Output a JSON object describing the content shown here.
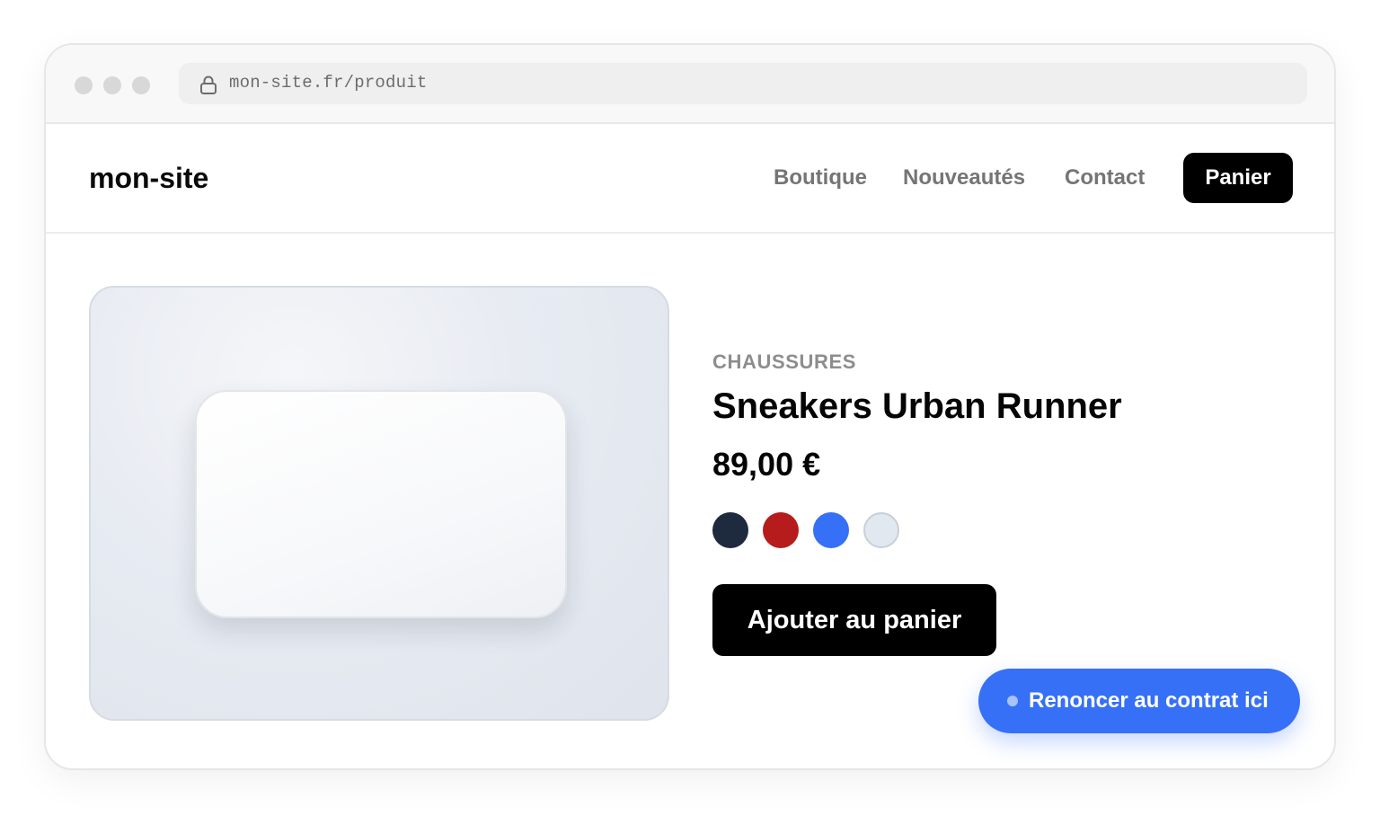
{
  "browser": {
    "url": "mon-site.fr/produit",
    "icons": {
      "lock": "lock-icon"
    }
  },
  "header": {
    "logo": "mon-site",
    "nav": [
      {
        "label": "Boutique"
      },
      {
        "label": "Nouveautés"
      },
      {
        "label": "Contact"
      }
    ],
    "cart_label": "Panier"
  },
  "product": {
    "category": "CHAUSSURES",
    "title": "Sneakers Urban Runner",
    "price": "89,00 €",
    "swatches": [
      {
        "color": "#1e2a3e"
      },
      {
        "color": "#b71c1c"
      },
      {
        "color": "#3670f7"
      },
      {
        "color": "#e2e8f0"
      }
    ],
    "add_to_cart_label": "Ajouter au panier"
  },
  "floating": {
    "withdraw_label": "Renoncer au contrat ici",
    "color": "#3670f7"
  }
}
